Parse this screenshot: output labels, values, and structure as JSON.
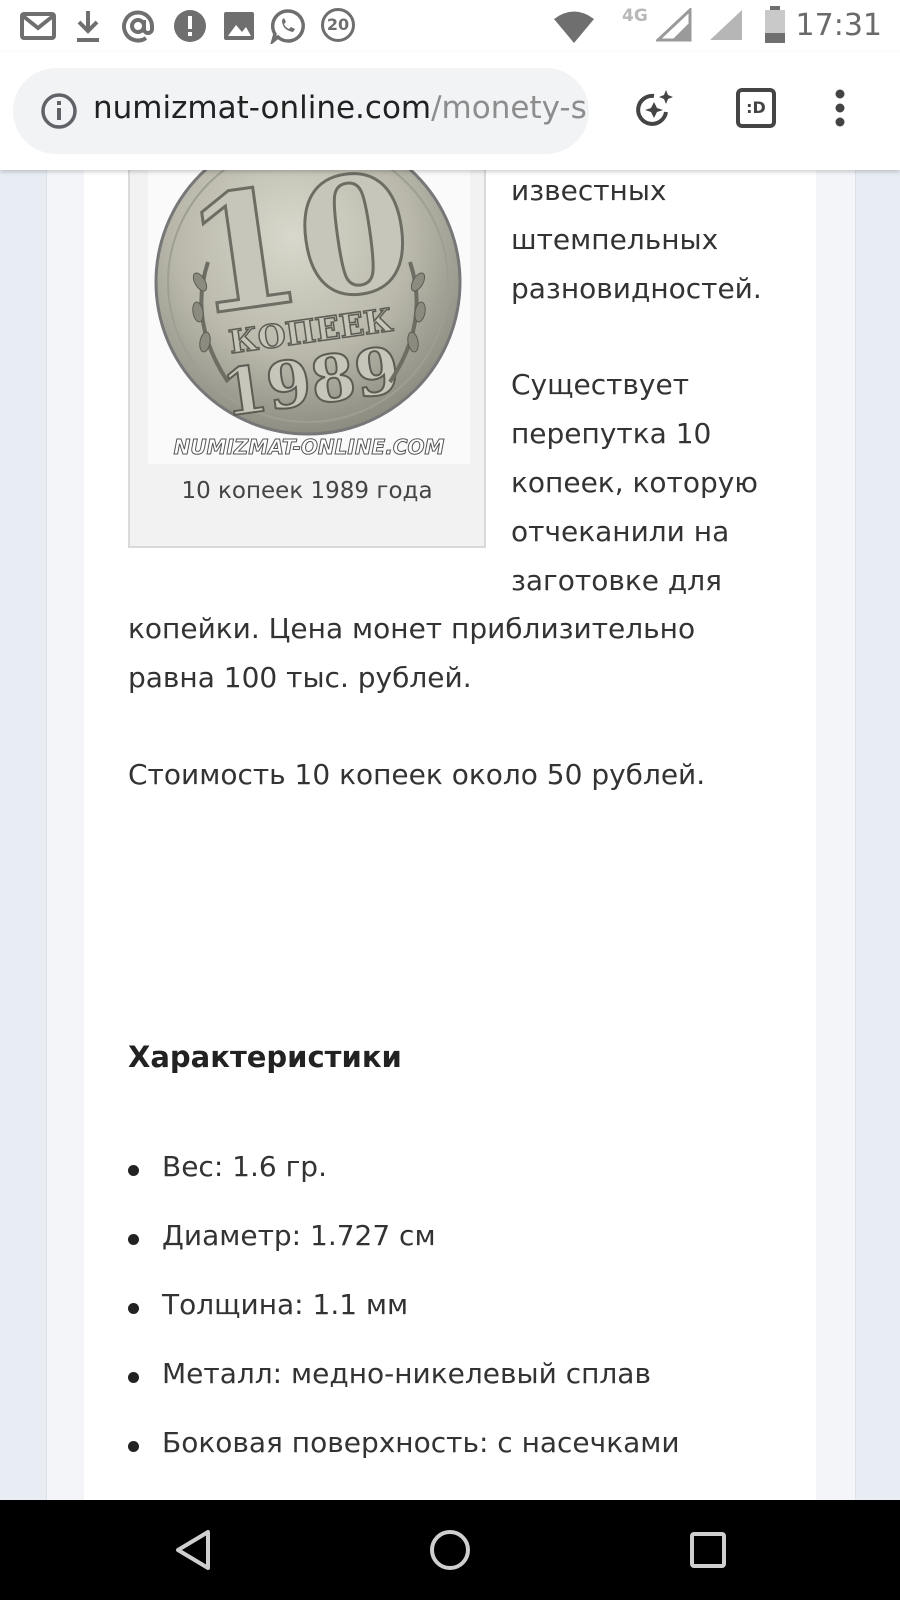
{
  "status_bar": {
    "time": "17:31",
    "network": "4G",
    "notification_badge": "20",
    "icons": [
      "gmail-icon",
      "download-icon",
      "at-sign-icon",
      "alert-icon",
      "image-icon",
      "whatsapp-icon",
      "badge-icon",
      "wifi-icon",
      "signal-icon",
      "battery-icon"
    ]
  },
  "browser": {
    "url_host": "numizmat-online.com",
    "url_path": "/monety-s",
    "icons": [
      "info-icon",
      "sparkle-icon",
      "tab-switcher-icon",
      "overflow-menu-icon"
    ],
    "tab_label": ":D"
  },
  "article": {
    "image_watermark": "NUMIZMAT-ONLINE.COM",
    "coin_text": {
      "value": "10",
      "unit": "КОПЕЕК",
      "year": "1989"
    },
    "image_caption": "10 копеек 1989 года",
    "side_lines": [
      "известных",
      "штемпельных",
      "разновидностей."
    ],
    "para_lines": [
      "Существует",
      "перепутка 10",
      "копеек, которую",
      "отчеканили на",
      "заготовке для"
    ],
    "para_full_lines": [
      "копейки. Цена монет приблизительно",
      "равна 100 тыс. рублей."
    ],
    "price_line": "Стоимость 10 копеек около 50 рублей.",
    "specs_heading": "Характеристики",
    "specs": [
      "Вес: 1.6 гр.",
      "Диаметр: 1.727 см",
      "Толщина: 1.1 мм",
      "Металл: медно-никелевый сплав",
      "Боковая поверхность: с насечками"
    ]
  },
  "colors": {
    "page_background": "#e8ecf3",
    "content_background": "#ffffff",
    "text": "#333333",
    "url_host": "#222222",
    "url_path": "#8d8d8d",
    "nav_bar": "#000000"
  },
  "nav_bar": {
    "icons": [
      "back-icon",
      "home-icon",
      "recents-icon"
    ]
  }
}
